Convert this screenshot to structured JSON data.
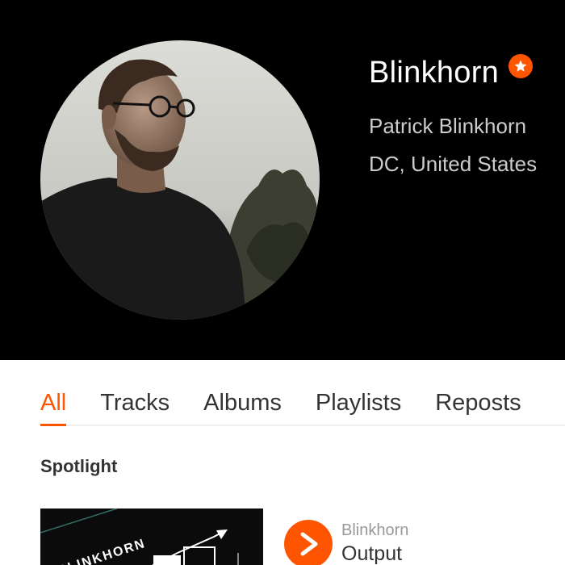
{
  "profile": {
    "username": "Blinkhorn",
    "full_name": "Patrick Blinkhorn",
    "location": "DC, United States",
    "badge_icon": "star-icon",
    "accent_color": "#ff5500"
  },
  "tabs": [
    {
      "label": "All",
      "active": true
    },
    {
      "label": "Tracks",
      "active": false
    },
    {
      "label": "Albums",
      "active": false
    },
    {
      "label": "Playlists",
      "active": false
    },
    {
      "label": "Reposts",
      "active": false
    }
  ],
  "spotlight": {
    "title": "Spotlight",
    "track": {
      "artist": "Blinkhorn",
      "title": "Output",
      "artwork_text": "BLINKHORN",
      "play_icon": "play-icon"
    }
  }
}
